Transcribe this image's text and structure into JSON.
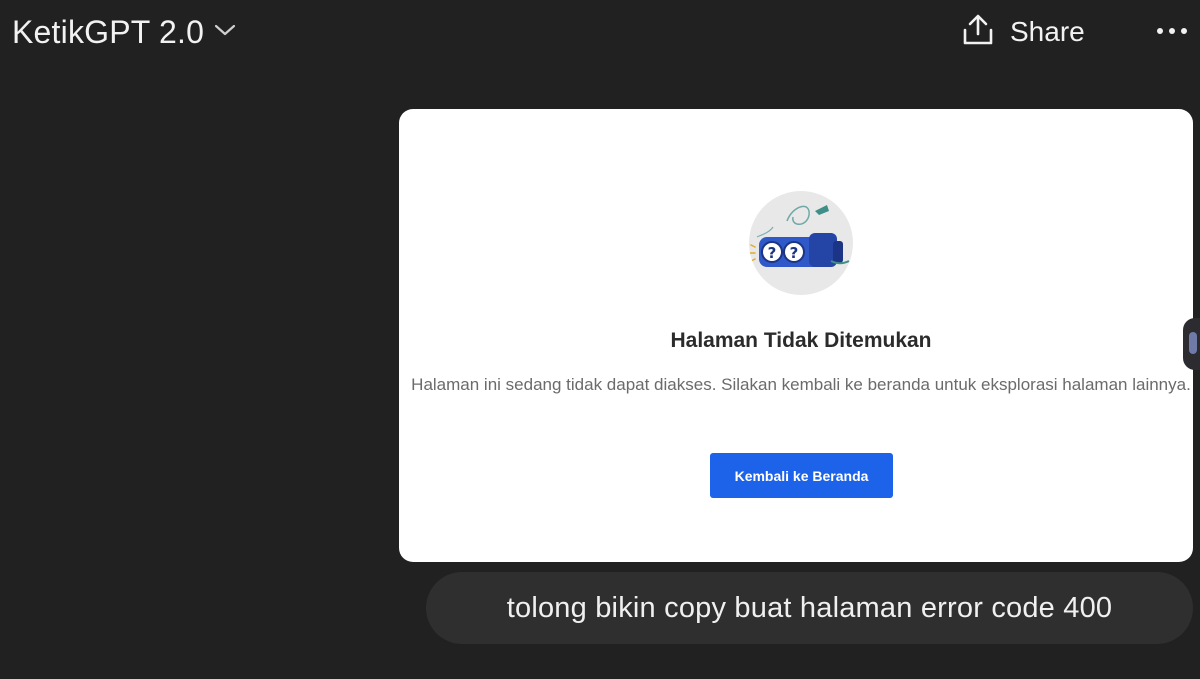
{
  "header": {
    "model_title": "KetikGPT 2.0",
    "model_chevron_icon": "chevron-down-icon",
    "share_label": "Share",
    "share_icon": "upload-icon",
    "more_icon": "ellipsis-icon"
  },
  "attachment": {
    "illustration_icon": "lost-telescope-illustration",
    "title": "Halaman Tidak Ditemukan",
    "description": "Halaman ini sedang tidak dapat diakses. Silakan kembali ke beranda untuk eksplorasi halaman lainnya.",
    "button_label": "Kembali ke Beranda",
    "button_color": "#1d63ea"
  },
  "message": {
    "text": "tolong bikin copy buat halaman error code 400"
  },
  "colors": {
    "background": "#212121",
    "bubble": "#2f2f2f",
    "card": "#ffffff"
  }
}
